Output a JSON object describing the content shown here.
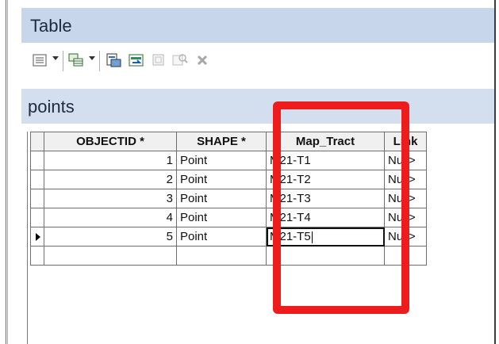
{
  "window": {
    "title": "Table"
  },
  "table": {
    "name": "points"
  },
  "toolbar": {
    "buttons": [
      "table-options-icon",
      "related-tables-icon",
      "select-by-attributes-icon",
      "switch-selection-icon",
      "clear-selection-icon",
      "zoom-to-selected-icon",
      "delete-selected-icon"
    ]
  },
  "grid": {
    "columns": [
      "OBJECTID *",
      "SHAPE *",
      "Map_Tract",
      "Link"
    ],
    "rows": [
      {
        "objectid": "1",
        "shape": "Point",
        "map_tract": "M21-T1",
        "link": "Null>"
      },
      {
        "objectid": "2",
        "shape": "Point",
        "map_tract": "M21-T2",
        "link": "Null>"
      },
      {
        "objectid": "3",
        "shape": "Point",
        "map_tract": "M21-T3",
        "link": "Null>"
      },
      {
        "objectid": "4",
        "shape": "Point",
        "map_tract": "M21-T4",
        "link": "Null>"
      },
      {
        "objectid": "5",
        "shape": "Point",
        "map_tract": "M21-T5",
        "link": "Null>"
      }
    ],
    "current_row": 5
  },
  "colors": {
    "annotation": "#ee1c1c",
    "title_bar": "#c7d6ea",
    "header_bar": "#d3dfef"
  }
}
